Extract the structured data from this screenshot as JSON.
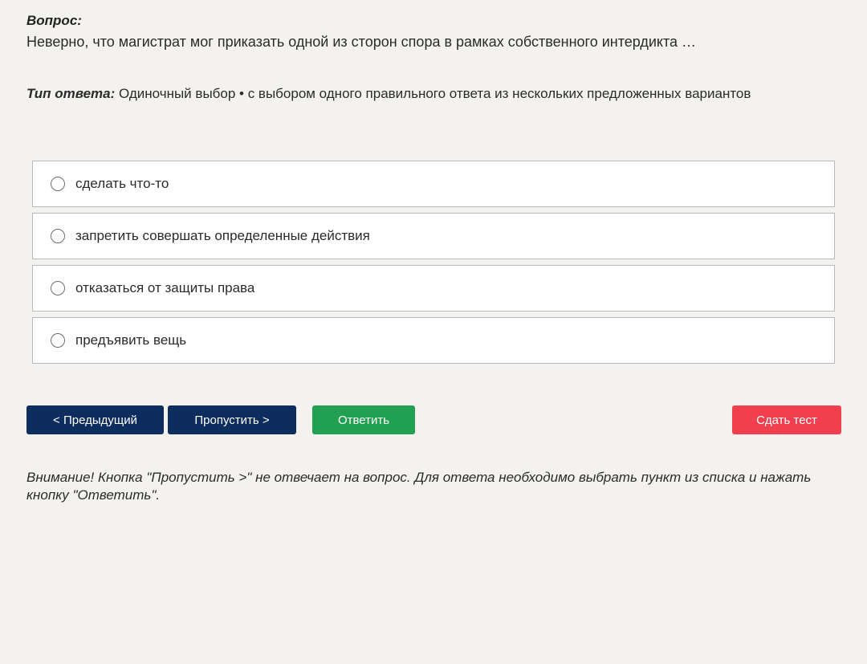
{
  "question": {
    "label": "Вопрос:",
    "text": "Неверно, что магистрат мог приказать одной из сторон спора в рамках собственного интердикта …"
  },
  "answer_type": {
    "label": "Тип ответа:",
    "value": " Одиночный выбор • с выбором одного правильного ответа из нескольких предложенных вариантов"
  },
  "options": [
    {
      "label": "сделать что-то",
      "selected": false
    },
    {
      "label": "запретить совершать определенные действия",
      "selected": false
    },
    {
      "label": "отказаться от защиты права",
      "selected": false
    },
    {
      "label": "предъявить вещь",
      "selected": false
    }
  ],
  "buttons": {
    "prev": "< Предыдущий",
    "skip": "Пропустить >",
    "answer": "Ответить",
    "finish": "Сдать тест"
  },
  "notice": "Внимание! Кнопка \"Пропустить >\" не отвечает на вопрос. Для ответа необходимо выбрать пункт из списка и нажать кнопку \"Ответить\".",
  "colors": {
    "background": "#f3f2ef",
    "primary_button": "#0d2d5e",
    "answer_button": "#22a052",
    "finish_button": "#f0404f"
  }
}
